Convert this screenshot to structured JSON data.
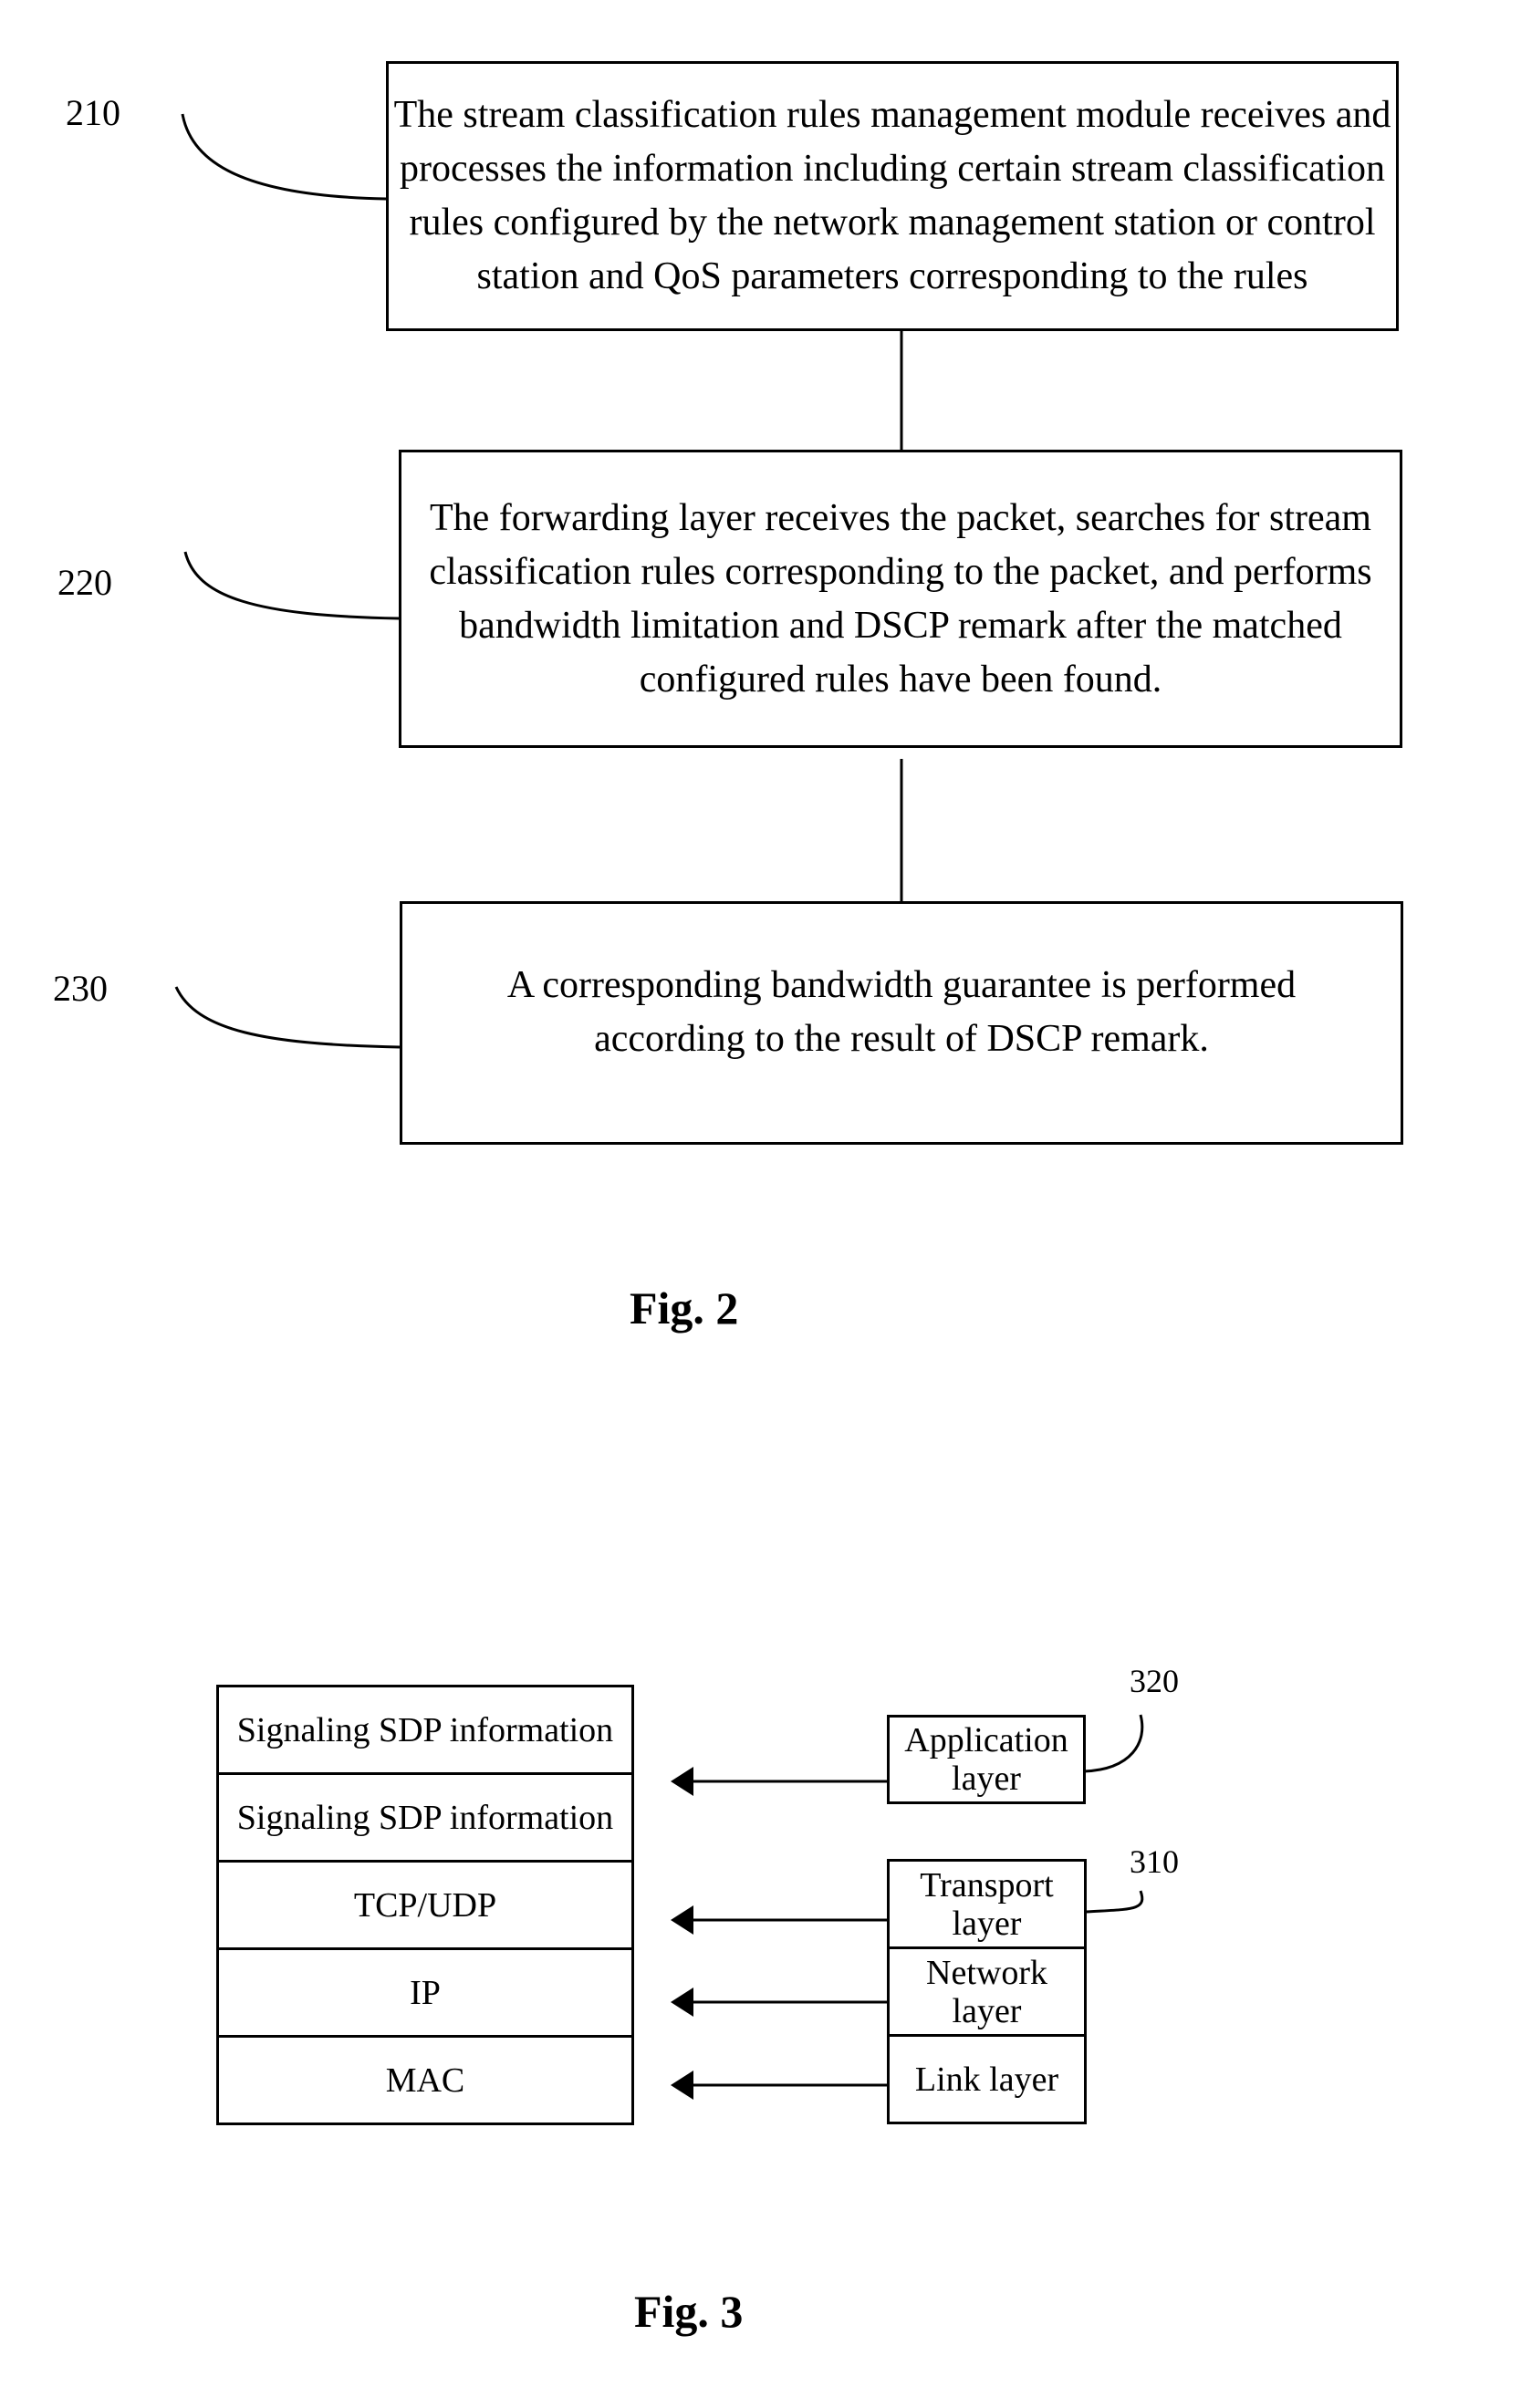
{
  "fig2": {
    "caption": "Fig. 2",
    "steps": [
      {
        "ref": "210",
        "text": "The stream classification rules management module receives and processes the information including certain stream classification rules configured by the network management station or control station and QoS parameters corresponding to the rules"
      },
      {
        "ref": "220",
        "text": "The forwarding layer receives the packet, searches for stream classification rules corresponding to the packet, and performs bandwidth limitation and DSCP remark after the matched configured rules have been found."
      },
      {
        "ref": "230",
        "text": "A corresponding bandwidth guarantee is performed according to the result of DSCP remark."
      }
    ]
  },
  "fig3": {
    "caption": "Fig. 3",
    "stack": [
      "Signaling SDP information",
      "Signaling SDP information",
      "TCP/UDP",
      "IP",
      "MAC"
    ],
    "layers": [
      "Application layer",
      "Transport layer",
      "Network layer",
      "Link layer"
    ],
    "refs": {
      "application": "320",
      "transport": "310"
    }
  }
}
